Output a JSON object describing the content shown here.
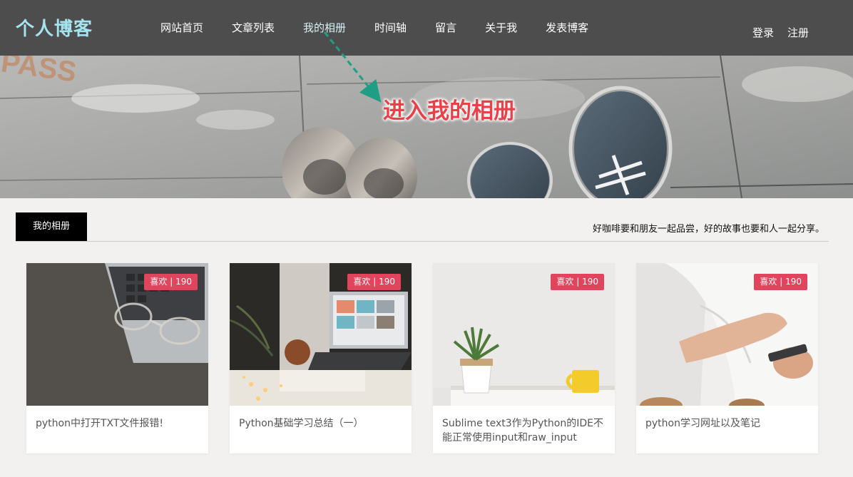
{
  "navbar": {
    "logo": "个人博客",
    "links": [
      "网站首页",
      "文章列表",
      "我的相册",
      "时间轴",
      "留言",
      "关于我",
      "发表博客"
    ],
    "active_index": 2,
    "login": "登录",
    "register": "注册",
    "background": "#4d4d4d",
    "logo_color": "#a5e3ee"
  },
  "annotation": {
    "text": "进入我的相册",
    "color": "#e8414a",
    "arrow_color": "#1f9e84"
  },
  "section": {
    "tab_label": "我的相册",
    "slogan": "好咖啡要和朋友一起品尝，好的故事也要和人一起分享。"
  },
  "cards": [
    {
      "like_badge": "喜欢 | 190",
      "title": "python中打开TXT文件报错!"
    },
    {
      "like_badge": "喜欢 | 190",
      "title": "Python基础学习总结（一）"
    },
    {
      "like_badge": "喜欢 | 190",
      "title": "Sublime text3作为Python的IDE不能正常使用input和raw_input"
    },
    {
      "like_badge": "喜欢 | 190",
      "title": "python学习网址以及笔记"
    }
  ],
  "colors": {
    "page_bg": "#f2f1ef",
    "badge_bg": "#e0455d"
  }
}
